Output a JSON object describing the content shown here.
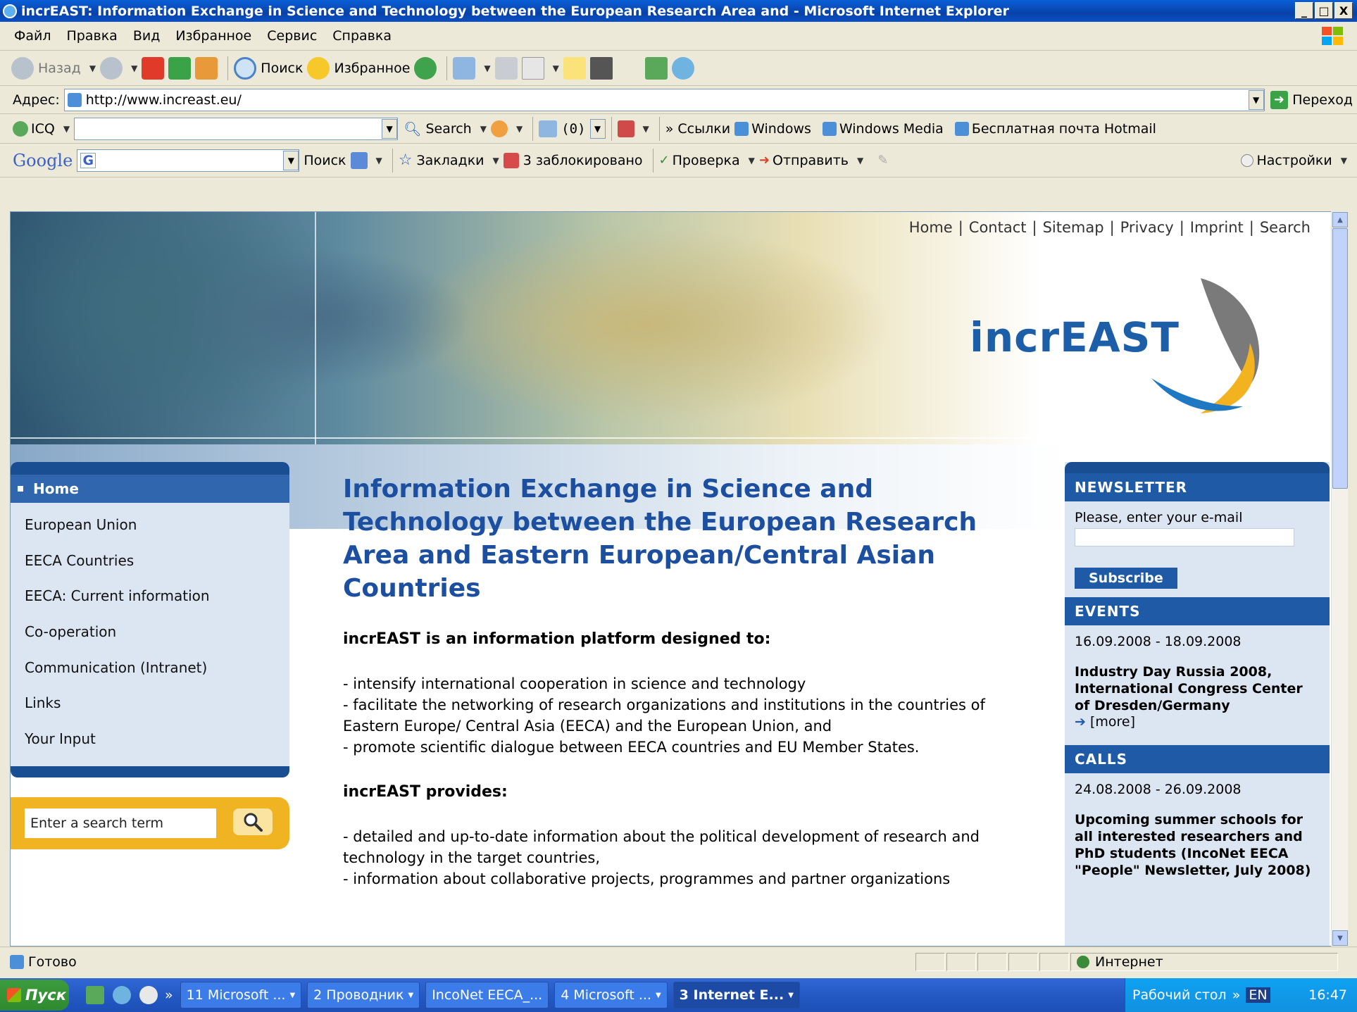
{
  "window": {
    "title": "incrEAST: Information Exchange in Science and Technology between the European Research Area and - Microsoft Internet Explorer",
    "minimize": "_",
    "maximize": "□",
    "close": "X"
  },
  "menubar": [
    "Файл",
    "Правка",
    "Вид",
    "Избранное",
    "Сервис",
    "Справка"
  ],
  "toolbar": {
    "back": "Назад",
    "search": "Поиск",
    "favorites": "Избранное"
  },
  "addressbar": {
    "label": "Адрес:",
    "url": "http://www.increast.eu/",
    "go": "Переход"
  },
  "icqbar": {
    "icq": "ICQ",
    "search": "Search",
    "mail_count": "(0)",
    "links_label": "Ссылки",
    "links": [
      "Windows",
      "Windows Media",
      "Бесплатная почта Hotmail"
    ],
    "more": "»"
  },
  "googlebar": {
    "logo": "Google",
    "search": "Поиск",
    "bookmarks": "Закладки",
    "blocked": "3 заблокировано",
    "spellcheck": "Проверка",
    "send": "Отправить",
    "settings": "Настройки"
  },
  "page": {
    "toplinks": [
      "Home",
      "Contact",
      "Sitemap",
      "Privacy",
      "Imprint",
      "Search"
    ],
    "logo_text": "incrEAST",
    "nav": {
      "home": "Home",
      "items": [
        "European Union",
        "EECA Countries",
        "EECA: Current information",
        "Co-operation",
        "Communication (Intranet)",
        "Links",
        "Your Input"
      ]
    },
    "search_placeholder": "Enter a search term",
    "main": {
      "heading": "Information Exchange in Science and Technology between the European Research Area and Eastern European/Central Asian Countries",
      "sub1": "incrEAST is an information platform designed to:",
      "list1": [
        "- intensify international cooperation in science and technology",
        "- facilitate the networking of research organizations and institutions in the countries of Eastern Europe/ Central Asia (EECA) and the European Union, and",
        "- promote scientific dialogue between EECA countries and EU Member States."
      ],
      "sub2": "incrEAST provides:",
      "list2": [
        "- detailed and up-to-date information about the political development of research and technology in the target countries,",
        "- information about collaborative projects, programmes and partner organizations"
      ]
    },
    "newsletter": {
      "heading": "NEWSLETTER",
      "prompt": "Please, enter your e-mail",
      "button": "Subscribe"
    },
    "events": {
      "heading": "EVENTS",
      "date": "16.09.2008 - 18.09.2008",
      "title": "Industry Day Russia 2008, International Congress Center of Dresden/Germany",
      "more": "[more]"
    },
    "calls": {
      "heading": "CALLS",
      "date": "24.08.2008 - 26.09.2008",
      "title": "Upcoming summer schools for all interested researchers and PhD students (IncoNet EECA \"People\" Newsletter, July 2008)"
    }
  },
  "statusbar": {
    "status": "Готово",
    "zone": "Интернет"
  },
  "taskbar": {
    "start": "Пуск",
    "more": "»",
    "buttons": [
      "11 Microsoft ...",
      "2 Проводник",
      "IncoNet EECA_...",
      "4 Microsoft ...",
      "3 Internet E..."
    ],
    "desktop": "Рабочий стол",
    "lang": "EN",
    "clock": "16:47"
  },
  "colors": {
    "brand_blue": "#1d4fa0",
    "nav_blue": "#1a4e92",
    "search_orange": "#f0b422",
    "xp_blue": "#0A4FC6"
  }
}
